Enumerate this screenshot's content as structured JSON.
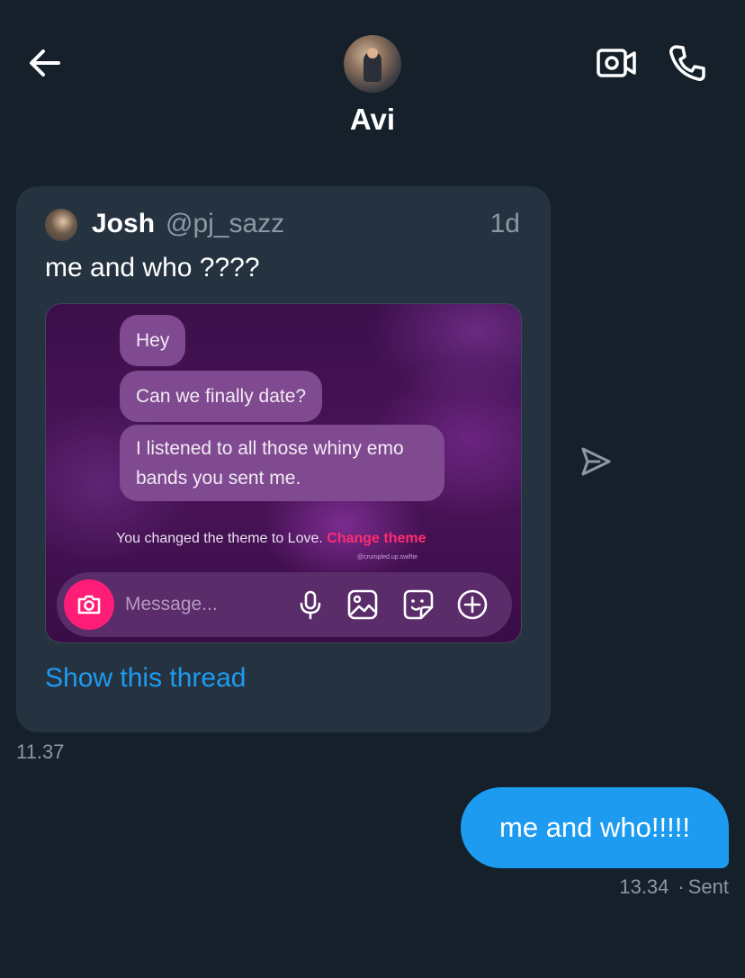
{
  "header": {
    "title": "Avi",
    "back_icon": "arrow-left-icon",
    "video_icon": "video-call-icon",
    "phone_icon": "phone-icon"
  },
  "quoted_tweet": {
    "name": "Josh",
    "handle": "@pj_sazz",
    "age": "1d",
    "text": "me and who ????",
    "media": {
      "bubbles": [
        "Hey",
        "Can we finally date?",
        "I listened to all those whiny emo bands you sent me."
      ],
      "theme_text": "You changed the theme to Love.",
      "theme_link": "Change theme",
      "watermark": "@crumpled.up.swiftie",
      "composer_placeholder": "Message...",
      "composer_icons": [
        "camera-icon",
        "microphone-icon",
        "image-icon",
        "sticker-icon",
        "plus-circle-icon"
      ]
    },
    "show_thread": "Show this thread"
  },
  "received_time": "11.37",
  "sent_message": {
    "text": "me and who!!!!!",
    "time": "13.34",
    "status": "Sent"
  },
  "colors": {
    "background": "#15202b",
    "card": "#253341",
    "accent": "#1d9bf0",
    "muted": "#8b98a5",
    "pink": "#ff2d6f"
  }
}
